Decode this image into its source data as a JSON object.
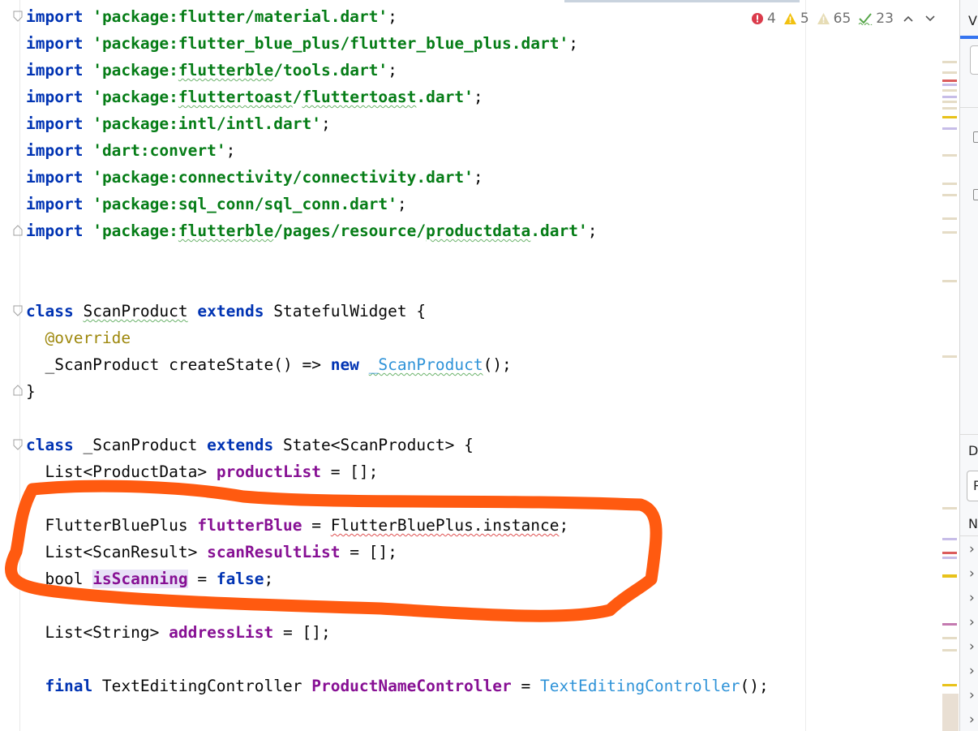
{
  "editor": {
    "imports": [
      {
        "kw": "import",
        "path": "'package:flutter/material.dart'",
        "end": ";"
      },
      {
        "kw": "import",
        "path": "'package:flutter_blue_plus/flutter_blue_plus.dart'",
        "end": ";"
      },
      {
        "kw": "import",
        "path_a": "'package:",
        "path_b": "flutterble",
        "path_c": "/tools.dart'",
        "end": ";"
      },
      {
        "kw": "import",
        "path_a": "'package:",
        "path_b": "fluttertoast",
        "path_c": "/",
        "path_d": "fluttertoast",
        "path_e": ".dart'",
        "end": ";"
      },
      {
        "kw": "import",
        "path": "'package:intl/intl.dart'",
        "end": ";"
      },
      {
        "kw": "import",
        "path": "'dart:convert'",
        "end": ";"
      },
      {
        "kw": "import",
        "path": "'package:connectivity/connectivity.dart'",
        "end": ";"
      },
      {
        "kw": "import",
        "path": "'package:sql_conn/sql_conn.dart'",
        "end": ";"
      },
      {
        "kw": "import",
        "path_a": "'package:",
        "path_b": "flutterble",
        "path_c": "/pages/resource/",
        "path_d": "productdata",
        "path_e": ".dart'",
        "end": ";"
      }
    ],
    "class1": {
      "kw_class": "class",
      "name": "ScanProduct",
      "kw_extends": "extends",
      "super": "StatefulWidget",
      "open": "{",
      "annotation": "@override",
      "method_ret": "_ScanProduct",
      "method_name": " createState() => ",
      "kw_new": "new",
      "ctor": "_ScanProduct",
      "method_end": "();",
      "close": "}"
    },
    "class2": {
      "kw_class": "class",
      "name": "_ScanProduct",
      "kw_extends": "extends",
      "super": "State<ScanProduct>",
      "open": "{",
      "l1_type": "List<ProductData> ",
      "l1_field": "productList",
      "l1_rest": " = [];",
      "l2_type": "FlutterBluePlus ",
      "l2_field": "flutterBlue",
      "l2_eq": " = ",
      "l2_val": "FlutterBluePlus.instance",
      "l2_end": ";",
      "l3_type": "List<ScanResult> ",
      "l3_field": "scanResultList",
      "l3_rest": " = [];",
      "l4_type": "bool ",
      "l4_field": "isScanning",
      "l4_eq": " = ",
      "l4_kw": "false",
      "l4_end": ";",
      "l5_type": "List<String> ",
      "l5_field": "addressList",
      "l5_rest": " = [];",
      "l6_kw": "final",
      "l6_type": " TextEditingController ",
      "l6_field": "ProductNameController",
      "l6_eq": " = ",
      "l6_ctor": "TextEditingController",
      "l6_end": "();"
    }
  },
  "inspection": {
    "errors": "4",
    "warnings": "5",
    "weak_warnings": "65",
    "typos": "23"
  },
  "right_panel": {
    "top_label": "Vi",
    "d_label": "D",
    "p_label": "P",
    "n_label": "N"
  },
  "colors": {
    "keyword": "#0033b3",
    "string": "#067d17",
    "field": "#871094",
    "annotation": "#9e880d",
    "constructor": "#2f93d8",
    "highlight_stroke": "#ff5a10"
  }
}
